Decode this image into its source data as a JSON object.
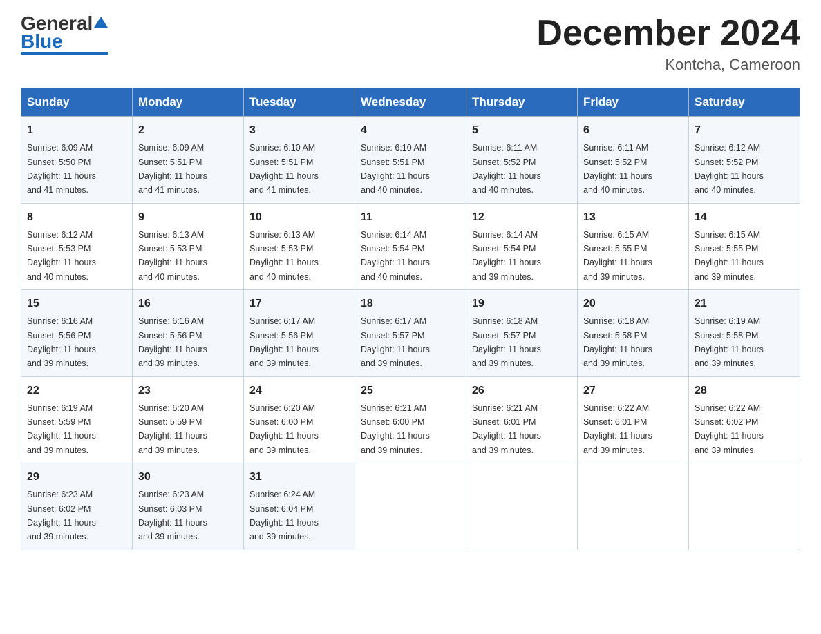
{
  "logo": {
    "general": "General",
    "blue": "Blue"
  },
  "header": {
    "month_title": "December 2024",
    "location": "Kontcha, Cameroon"
  },
  "days_of_week": [
    "Sunday",
    "Monday",
    "Tuesday",
    "Wednesday",
    "Thursday",
    "Friday",
    "Saturday"
  ],
  "weeks": [
    [
      {
        "day": "1",
        "sunrise": "6:09 AM",
        "sunset": "5:50 PM",
        "daylight": "11 hours and 41 minutes."
      },
      {
        "day": "2",
        "sunrise": "6:09 AM",
        "sunset": "5:51 PM",
        "daylight": "11 hours and 41 minutes."
      },
      {
        "day": "3",
        "sunrise": "6:10 AM",
        "sunset": "5:51 PM",
        "daylight": "11 hours and 41 minutes."
      },
      {
        "day": "4",
        "sunrise": "6:10 AM",
        "sunset": "5:51 PM",
        "daylight": "11 hours and 40 minutes."
      },
      {
        "day": "5",
        "sunrise": "6:11 AM",
        "sunset": "5:52 PM",
        "daylight": "11 hours and 40 minutes."
      },
      {
        "day": "6",
        "sunrise": "6:11 AM",
        "sunset": "5:52 PM",
        "daylight": "11 hours and 40 minutes."
      },
      {
        "day": "7",
        "sunrise": "6:12 AM",
        "sunset": "5:52 PM",
        "daylight": "11 hours and 40 minutes."
      }
    ],
    [
      {
        "day": "8",
        "sunrise": "6:12 AM",
        "sunset": "5:53 PM",
        "daylight": "11 hours and 40 minutes."
      },
      {
        "day": "9",
        "sunrise": "6:13 AM",
        "sunset": "5:53 PM",
        "daylight": "11 hours and 40 minutes."
      },
      {
        "day": "10",
        "sunrise": "6:13 AM",
        "sunset": "5:53 PM",
        "daylight": "11 hours and 40 minutes."
      },
      {
        "day": "11",
        "sunrise": "6:14 AM",
        "sunset": "5:54 PM",
        "daylight": "11 hours and 40 minutes."
      },
      {
        "day": "12",
        "sunrise": "6:14 AM",
        "sunset": "5:54 PM",
        "daylight": "11 hours and 39 minutes."
      },
      {
        "day": "13",
        "sunrise": "6:15 AM",
        "sunset": "5:55 PM",
        "daylight": "11 hours and 39 minutes."
      },
      {
        "day": "14",
        "sunrise": "6:15 AM",
        "sunset": "5:55 PM",
        "daylight": "11 hours and 39 minutes."
      }
    ],
    [
      {
        "day": "15",
        "sunrise": "6:16 AM",
        "sunset": "5:56 PM",
        "daylight": "11 hours and 39 minutes."
      },
      {
        "day": "16",
        "sunrise": "6:16 AM",
        "sunset": "5:56 PM",
        "daylight": "11 hours and 39 minutes."
      },
      {
        "day": "17",
        "sunrise": "6:17 AM",
        "sunset": "5:56 PM",
        "daylight": "11 hours and 39 minutes."
      },
      {
        "day": "18",
        "sunrise": "6:17 AM",
        "sunset": "5:57 PM",
        "daylight": "11 hours and 39 minutes."
      },
      {
        "day": "19",
        "sunrise": "6:18 AM",
        "sunset": "5:57 PM",
        "daylight": "11 hours and 39 minutes."
      },
      {
        "day": "20",
        "sunrise": "6:18 AM",
        "sunset": "5:58 PM",
        "daylight": "11 hours and 39 minutes."
      },
      {
        "day": "21",
        "sunrise": "6:19 AM",
        "sunset": "5:58 PM",
        "daylight": "11 hours and 39 minutes."
      }
    ],
    [
      {
        "day": "22",
        "sunrise": "6:19 AM",
        "sunset": "5:59 PM",
        "daylight": "11 hours and 39 minutes."
      },
      {
        "day": "23",
        "sunrise": "6:20 AM",
        "sunset": "5:59 PM",
        "daylight": "11 hours and 39 minutes."
      },
      {
        "day": "24",
        "sunrise": "6:20 AM",
        "sunset": "6:00 PM",
        "daylight": "11 hours and 39 minutes."
      },
      {
        "day": "25",
        "sunrise": "6:21 AM",
        "sunset": "6:00 PM",
        "daylight": "11 hours and 39 minutes."
      },
      {
        "day": "26",
        "sunrise": "6:21 AM",
        "sunset": "6:01 PM",
        "daylight": "11 hours and 39 minutes."
      },
      {
        "day": "27",
        "sunrise": "6:22 AM",
        "sunset": "6:01 PM",
        "daylight": "11 hours and 39 minutes."
      },
      {
        "day": "28",
        "sunrise": "6:22 AM",
        "sunset": "6:02 PM",
        "daylight": "11 hours and 39 minutes."
      }
    ],
    [
      {
        "day": "29",
        "sunrise": "6:23 AM",
        "sunset": "6:02 PM",
        "daylight": "11 hours and 39 minutes."
      },
      {
        "day": "30",
        "sunrise": "6:23 AM",
        "sunset": "6:03 PM",
        "daylight": "11 hours and 39 minutes."
      },
      {
        "day": "31",
        "sunrise": "6:24 AM",
        "sunset": "6:04 PM",
        "daylight": "11 hours and 39 minutes."
      },
      null,
      null,
      null,
      null
    ]
  ],
  "labels": {
    "sunrise": "Sunrise:",
    "sunset": "Sunset:",
    "daylight": "Daylight:"
  }
}
